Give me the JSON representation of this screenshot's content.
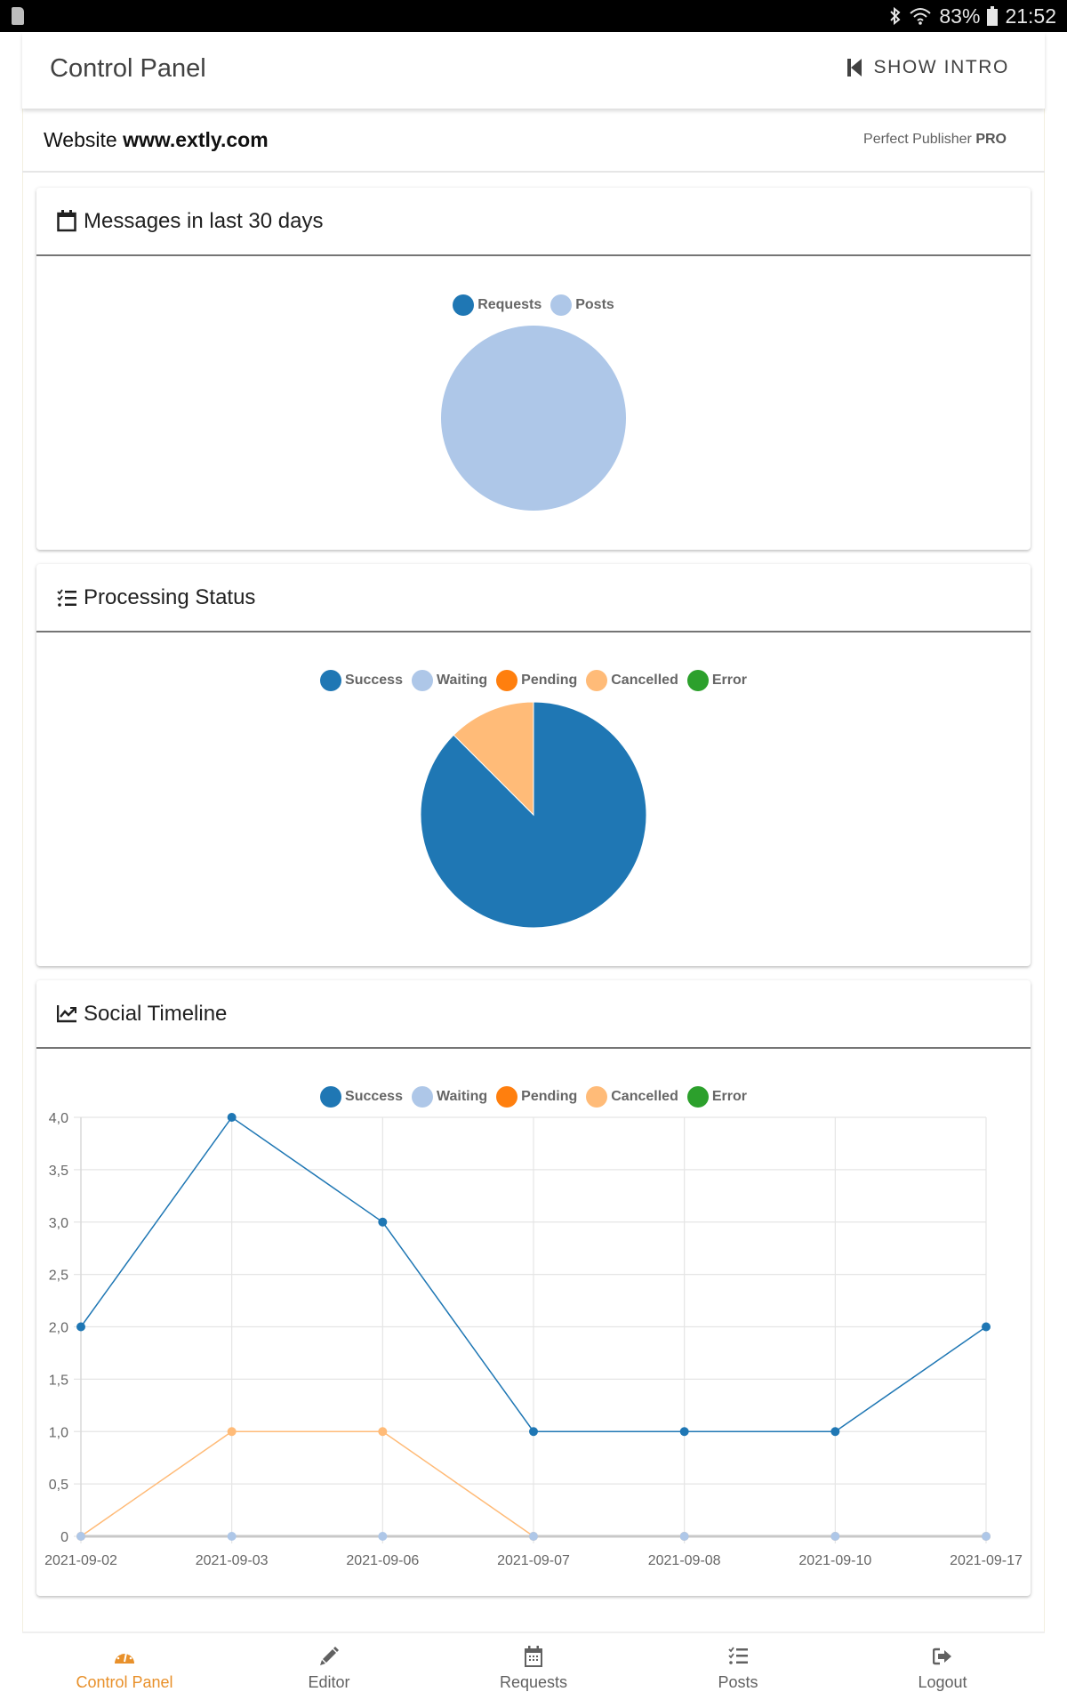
{
  "status_bar": {
    "battery": "83%",
    "time": "21:52",
    "icons": [
      "sd-card-icon",
      "bluetooth-icon",
      "wifi-icon",
      "battery-icon"
    ]
  },
  "header": {
    "title": "Control Panel",
    "show_intro_label": "SHOW INTRO",
    "show_intro_icon": "skip-previous-icon"
  },
  "site": {
    "prefix": "Website",
    "domain": "www.extly.com",
    "product_name": "Perfect Publisher",
    "product_tier": "PRO"
  },
  "colors": {
    "accent": "#e8902a",
    "success": "#1f77b4",
    "waiting": "#aec7e8",
    "pending": "#ff7f0e",
    "cancelled": "#ffbb78",
    "error": "#2ca02c"
  },
  "cards": {
    "messages": {
      "title": "Messages in last 30 days",
      "icon": "calendar-icon"
    },
    "processing": {
      "title": "Processing Status",
      "icon": "checklist-icon"
    },
    "timeline": {
      "title": "Social Timeline",
      "icon": "line-chart-icon"
    }
  },
  "chart_data": [
    {
      "type": "pie",
      "title": "Messages in last 30 days",
      "legend": "top",
      "labels": [
        "Requests",
        "Posts"
      ],
      "colors": [
        "#1f77b4",
        "#aec7e8"
      ],
      "values": [
        0,
        16
      ]
    },
    {
      "type": "pie",
      "title": "Processing Status",
      "legend": "top",
      "labels": [
        "Success",
        "Waiting",
        "Pending",
        "Cancelled",
        "Error"
      ],
      "colors": [
        "#1f77b4",
        "#aec7e8",
        "#ff7f0e",
        "#ffbb78",
        "#2ca02c"
      ],
      "values": [
        14,
        0,
        0,
        2,
        0
      ]
    },
    {
      "type": "line",
      "title": "Social Timeline",
      "legend": "top",
      "categories": [
        "2021-09-02",
        "2021-09-03",
        "2021-09-06",
        "2021-09-07",
        "2021-09-08",
        "2021-09-10",
        "2021-09-17"
      ],
      "ylim": [
        0,
        4
      ],
      "yticks": [
        "0",
        "0,5",
        "1,0",
        "1,5",
        "2,0",
        "2,5",
        "3,0",
        "3,5",
        "4,0"
      ],
      "grid": true,
      "series": [
        {
          "name": "Success",
          "color": "#1f77b4",
          "values": [
            2,
            4,
            3,
            1,
            1,
            1,
            2
          ]
        },
        {
          "name": "Waiting",
          "color": "#aec7e8",
          "values": [
            0,
            0,
            0,
            0,
            0,
            0,
            0
          ]
        },
        {
          "name": "Pending",
          "color": "#ff7f0e",
          "values": [
            0,
            0,
            0,
            0,
            0,
            0,
            0
          ]
        },
        {
          "name": "Cancelled",
          "color": "#ffbb78",
          "values": [
            0,
            1,
            1,
            0,
            0,
            0,
            0
          ]
        },
        {
          "name": "Error",
          "color": "#2ca02c",
          "values": [
            0,
            0,
            0,
            0,
            0,
            0,
            0
          ]
        }
      ]
    }
  ],
  "bottom_nav": [
    {
      "label": "Control Panel",
      "icon": "dashboard-icon",
      "active": true
    },
    {
      "label": "Editor",
      "icon": "pencil-icon",
      "active": false
    },
    {
      "label": "Requests",
      "icon": "calendar-icon",
      "active": false
    },
    {
      "label": "Posts",
      "icon": "checklist-icon",
      "active": false
    },
    {
      "label": "Logout",
      "icon": "logout-icon",
      "active": false
    }
  ]
}
